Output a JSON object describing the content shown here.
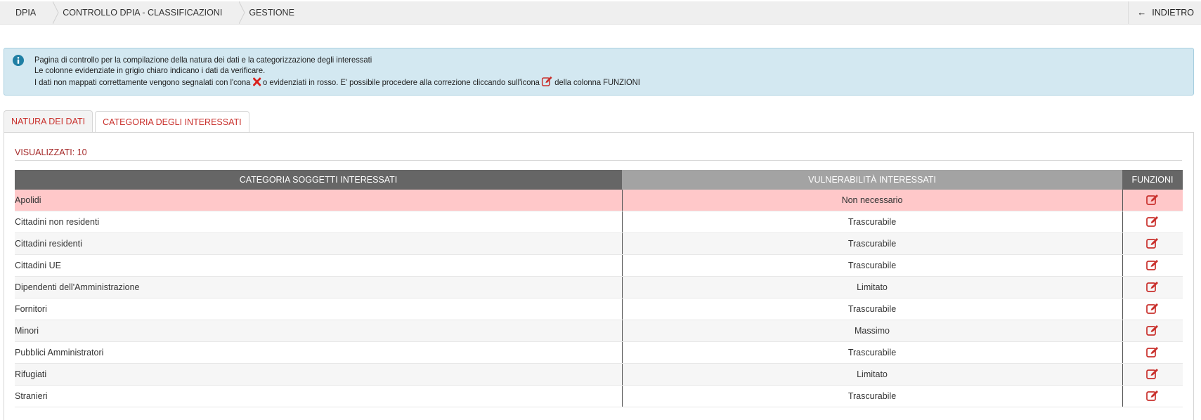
{
  "breadcrumb": {
    "items": [
      "DPIA",
      "CONTROLLO DPIA - CLASSIFICAZIONI",
      "GESTIONE"
    ],
    "back_icon": "←",
    "back_label": "INDIETRO"
  },
  "info": {
    "line1": "Pagina di controllo per la compilazione della natura dei dati e la categorizzazione degli interessati",
    "line2": "Le colonne evidenziate in grigio chiaro indicano i dati da verificare.",
    "line3_a": "I dati non mappati correttamente vengono segnalati con l'cona",
    "line3_b": "o evidenziati in rosso. E' possibile procedere alla correzione cliccando sull'icona",
    "line3_c": "della colonna FUNZIONI"
  },
  "tabs": [
    {
      "label": "NATURA DEI DATI",
      "active": false
    },
    {
      "label": "CATEGORIA DEGLI INTERESSATI",
      "active": true
    }
  ],
  "panel": {
    "count_label": "VISUALIZZATI: 10"
  },
  "table": {
    "headers": [
      "CATEGORIA SOGGETTI INTERESSATI",
      "VULNERABILITÀ INTERESSATI",
      "FUNZIONI"
    ],
    "rows": [
      {
        "categoria": "Apolidi",
        "vulnerabilita": "Non necessario",
        "error": true
      },
      {
        "categoria": "Cittadini non residenti",
        "vulnerabilita": "Trascurabile",
        "error": false
      },
      {
        "categoria": "Cittadini residenti",
        "vulnerabilita": "Trascurabile",
        "error": false
      },
      {
        "categoria": "Cittadini UE",
        "vulnerabilita": "Trascurabile",
        "error": false
      },
      {
        "categoria": "Dipendenti dell'Amministrazione",
        "vulnerabilita": "Limitato",
        "error": false
      },
      {
        "categoria": "Fornitori",
        "vulnerabilita": "Trascurabile",
        "error": false
      },
      {
        "categoria": "Minori",
        "vulnerabilita": "Massimo",
        "error": false
      },
      {
        "categoria": "Pubblici Amministratori",
        "vulnerabilita": "Trascurabile",
        "error": false
      },
      {
        "categoria": "Rifugiati",
        "vulnerabilita": "Limitato",
        "error": false
      },
      {
        "categoria": "Stranieri",
        "vulnerabilita": "Trascurabile",
        "error": false
      }
    ]
  },
  "colors": {
    "accent_red": "#c9302c",
    "error_row": "#ffc8c9",
    "info_bg": "#d3e8f1",
    "info_icon": "#1f7fa4",
    "header_dark": "#666666",
    "header_light": "#a3a3a3"
  },
  "icons": {
    "info": "info-circle-icon",
    "error": "red-x-icon",
    "edit": "edit-square-icon",
    "back": "arrow-left-icon"
  }
}
